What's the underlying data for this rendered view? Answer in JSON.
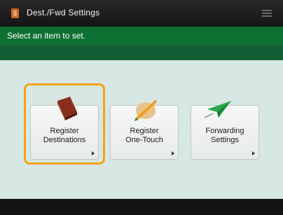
{
  "header": {
    "title": "Dest./Fwd Settings",
    "app_icon": "address-book-icon",
    "menu_icon": "menu-icon"
  },
  "instruction": "Select an item to set.",
  "tiles": [
    {
      "line1": "Register",
      "line2": "Destinations",
      "icon": "address-book-icon",
      "selected": true
    },
    {
      "line1": "Register",
      "line2": "One-Touch",
      "icon": "one-touch-pen-icon",
      "selected": false
    },
    {
      "line1": "Forwarding",
      "line2": "Settings",
      "icon": "forwarding-plane-icon",
      "selected": false
    }
  ],
  "colors": {
    "instruction_bar": "#0f7033",
    "selection_ring": "#f3a31b",
    "content_bg": "#d7e7e3"
  }
}
